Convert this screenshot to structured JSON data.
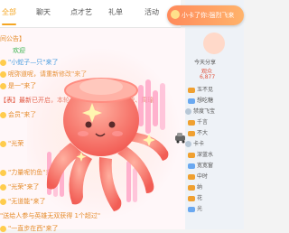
{
  "tabs": [
    {
      "label": "全部",
      "active": true
    },
    {
      "label": "聊天",
      "active": false
    },
    {
      "label": "点才艺",
      "active": false
    },
    {
      "label": "礼单",
      "active": false
    },
    {
      "label": "活动",
      "active": false
    }
  ],
  "chat": {
    "messages": [
      {
        "text": "间公告】",
        "color": "orange"
      },
      {
        "text": "欢迎",
        "color": "green"
      },
      {
        "text": "\"小蛇子—只\"来了",
        "color": "blue"
      },
      {
        "text": "呢弥道呢，请重新修改\"来了",
        "color": "orange"
      },
      {
        "text": "是一\"来了",
        "color": "orange"
      },
      {
        "text": "【表】最新已开启，本轮最新英雄:司马懿、庞统、周瑜",
        "color": "red"
      },
      {
        "text": "会员\"来了",
        "color": "orange"
      },
      {
        "text": "\"光荣",
        "color": "orange"
      },
      {
        "text": "\"力量呢钓鱼\"来了",
        "color": "orange"
      },
      {
        "text": "\"光荣\"来了",
        "color": "orange"
      },
      {
        "text": "\"无道能\"来了",
        "color": "orange"
      },
      {
        "text": "\"送给人参与英雄无双获得 1个超过\"",
        "color": "orange"
      },
      {
        "text": "\"一直步在西\"来了",
        "color": "orange"
      }
    ]
  },
  "banner": {
    "text": "小卡了你:强烈飞来"
  },
  "right_panel": {
    "header": "今天分享",
    "count_label": "观众",
    "count": "6,877",
    "rows": [
      {
        "text": "玉不见"
      },
      {
        "text": "想吃糖"
      },
      {
        "text": "禁度飞宝"
      },
      {
        "text": "千言"
      },
      {
        "text": "不大"
      },
      {
        "text": "卡卡"
      },
      {
        "text": "深蓝水"
      },
      {
        "text": "宽宽窗"
      },
      {
        "text": "中时"
      },
      {
        "text": "纳"
      },
      {
        "text": "花"
      },
      {
        "text": "光"
      }
    ]
  },
  "colors": {
    "accent": "#f5a623",
    "chat_bg": "#fff7f9",
    "banner": "#ff8a5b",
    "octopus": "#ff7f72"
  }
}
